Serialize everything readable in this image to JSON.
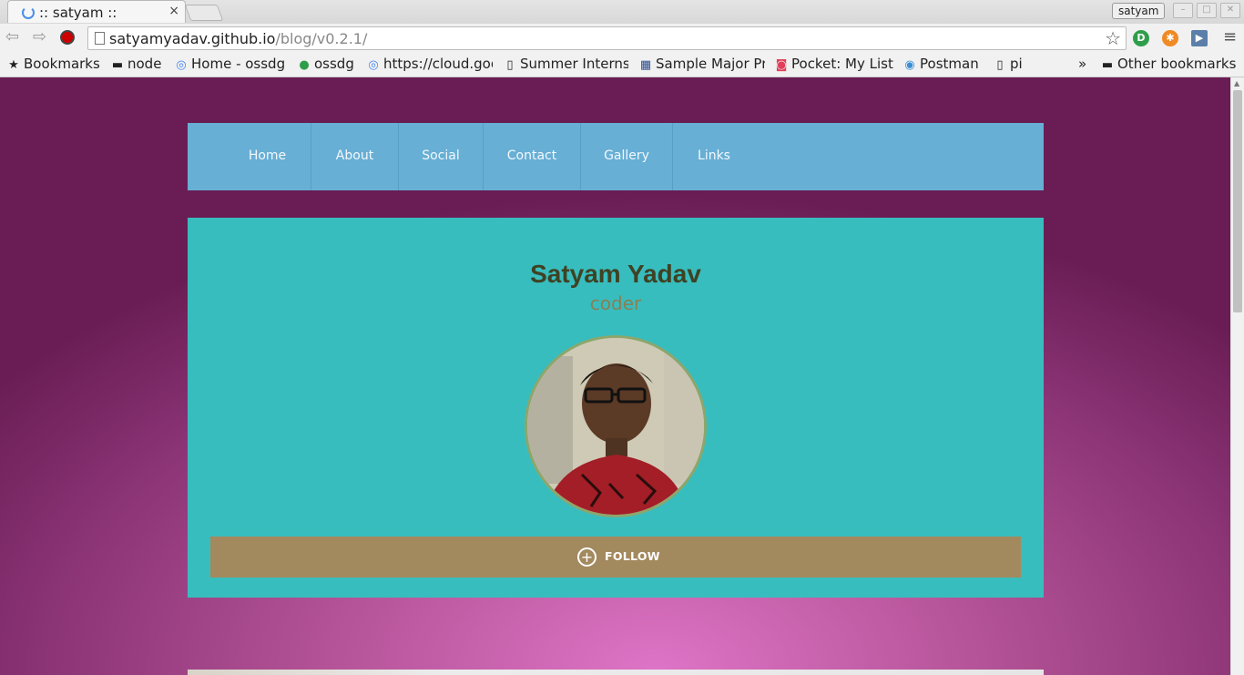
{
  "browser": {
    "tab_title": ":: satyam ::",
    "tab_close": "×",
    "profile_name": "satyam",
    "window_buttons": [
      "–",
      "□",
      "✕"
    ],
    "url_host": "satyamyadav.github.io",
    "url_path": "/blog/v0.2.1/",
    "star_icon": "☆",
    "menu_icon": "≡"
  },
  "bookmarks": {
    "items": [
      {
        "label": "Bookmarks",
        "icon": "star-icon"
      },
      {
        "label": "node",
        "icon": "folder-icon"
      },
      {
        "label": "Home - ossdg",
        "icon": "google-icon"
      },
      {
        "label": "ossdg",
        "icon": "github-icon"
      },
      {
        "label": "https://cloud.google.com",
        "icon": "google-icon"
      },
      {
        "label": "Summer Internship",
        "icon": "page-icon"
      },
      {
        "label": "Sample Major Project",
        "icon": "grid-icon"
      },
      {
        "label": "Pocket: My List",
        "icon": "pocket-icon"
      },
      {
        "label": "Postman",
        "icon": "globe-icon"
      },
      {
        "label": "pi",
        "icon": "page-icon"
      }
    ],
    "overflow": "»",
    "other": "Other bookmarks"
  },
  "site": {
    "nav": [
      "Home",
      "About",
      "Social",
      "Contact",
      "Gallery",
      "Links"
    ],
    "profile_name": "Satyam Yadav",
    "profile_role": "coder",
    "follow_label": "FOLLOW",
    "follow_icon": "+"
  },
  "colors": {
    "nav_bg": "#67afd5",
    "card_bg": "#38bdbe",
    "follow_bg": "#a3895e",
    "page_bg": "#b45397"
  }
}
